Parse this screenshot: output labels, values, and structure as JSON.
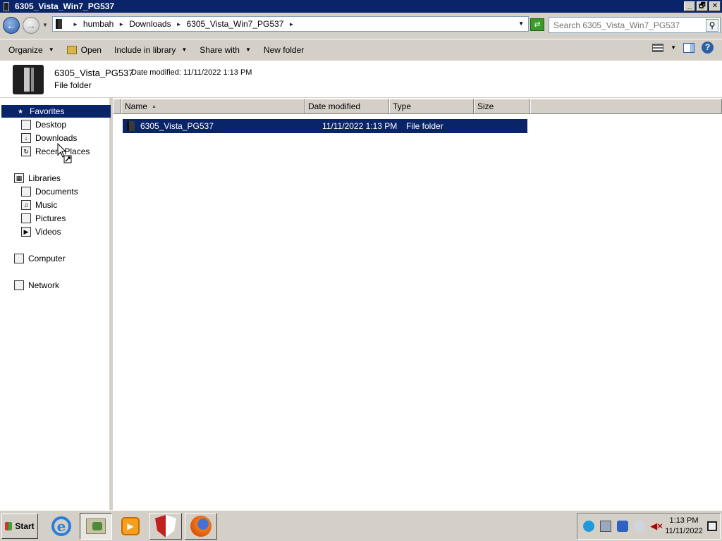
{
  "window": {
    "title": "6305_Vista_Win7_PG537",
    "buttons": {
      "minimize": "_",
      "maximize": "🗗",
      "close": "✕"
    }
  },
  "address": {
    "breadcrumbs": [
      "humbah",
      "Downloads",
      "6305_Vista_Win7_PG537"
    ],
    "search_placeholder": "Search 6305_Vista_Win7_PG537"
  },
  "toolbar": {
    "organize": "Organize",
    "open": "Open",
    "include_in_library": "Include in library",
    "share_with": "Share with",
    "new_folder": "New folder"
  },
  "details": {
    "name": "6305_Vista_PG537",
    "date_label": "Date modified:",
    "date_value": "11/11/2022 1:13 PM",
    "type": "File folder"
  },
  "nav": {
    "favorites": "Favorites",
    "desktop": "Desktop",
    "downloads": "Downloads",
    "recent_places": "Recent Places",
    "libraries": "Libraries",
    "documents": "Documents",
    "music": "Music",
    "pictures": "Pictures",
    "videos": "Videos",
    "computer": "Computer",
    "network": "Network"
  },
  "columns": {
    "name": "Name",
    "date_modified": "Date modified",
    "type": "Type",
    "size": "Size"
  },
  "files": [
    {
      "name": "6305_Vista_PG537",
      "date": "11/11/2022 1:13 PM",
      "type": "File folder",
      "size": ""
    }
  ],
  "taskbar": {
    "start": "Start",
    "time": "1:13 PM",
    "date": "11/11/2022"
  },
  "colors": {
    "selection": "#0a246a",
    "chrome": "#d4d0c8"
  }
}
